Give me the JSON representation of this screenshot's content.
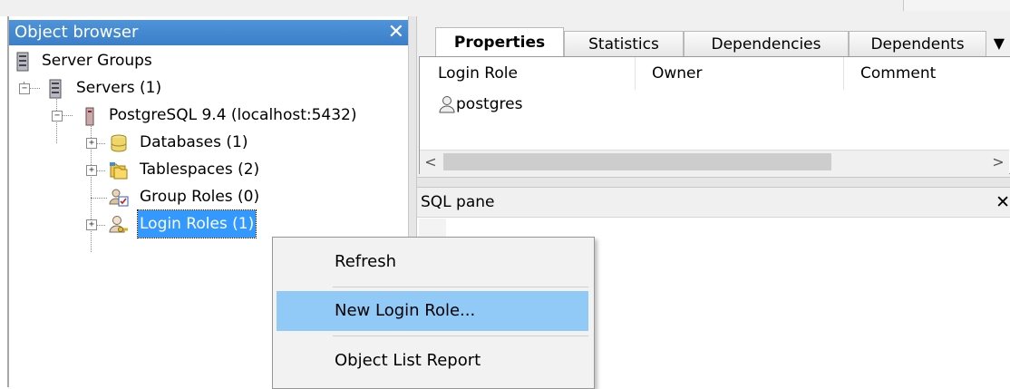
{
  "object_browser": {
    "title": "Object browser",
    "close_glyph": "✕",
    "tree": [
      {
        "label": "Server Groups",
        "icon": "server-groups-icon"
      },
      {
        "label": "Servers (1)",
        "icon": "servers-icon",
        "expander": "−"
      },
      {
        "label": "PostgreSQL 9.4 (localhost:5432)",
        "icon": "server-icon",
        "expander": "−"
      },
      {
        "label": "Databases (1)",
        "icon": "database-icon",
        "expander": "+"
      },
      {
        "label": "Tablespaces (2)",
        "icon": "tablespace-icon",
        "expander": "+"
      },
      {
        "label": "Group Roles (0)",
        "icon": "group-role-icon"
      },
      {
        "label": "Login Roles (1)",
        "icon": "login-role-icon",
        "expander": "+",
        "selected": true
      }
    ]
  },
  "properties": {
    "tabs": [
      {
        "label": "Properties",
        "active": true
      },
      {
        "label": "Statistics"
      },
      {
        "label": "Dependencies"
      },
      {
        "label": "Dependents"
      }
    ],
    "tab_overflow": "▼",
    "columns": [
      "Login Role",
      "Owner",
      "Comment"
    ],
    "rows": [
      {
        "login_role": "postgres",
        "icon": "user-icon"
      }
    ],
    "scroll_left": "<",
    "scroll_right": ">"
  },
  "sql_pane": {
    "title": "SQL pane",
    "close_glyph": "✕"
  },
  "context_menu": {
    "items": [
      {
        "label": "Refresh"
      },
      {
        "label": "New Login Role...",
        "highlighted": true
      },
      {
        "label": "Object List Report"
      }
    ]
  },
  "colors": {
    "titlebar": "#3a7fc9",
    "selection": "#3399ff",
    "menu_highlight": "#91c9f7"
  }
}
